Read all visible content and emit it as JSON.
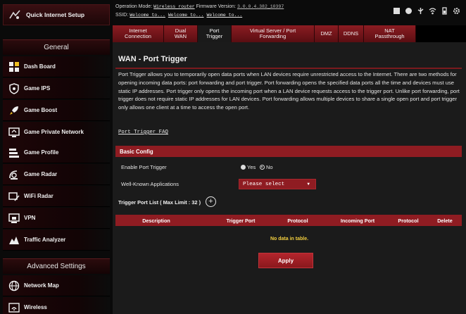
{
  "colors": {
    "accent": "#8f1c22",
    "background": "#1b1b1b",
    "nodata": "#f3cf3f"
  },
  "sidebar": {
    "quick_setup": {
      "label": "Quick Internet Setup",
      "icon": "quick-setup-icon"
    },
    "general_label": "General",
    "items": [
      {
        "label": "Dash Board",
        "icon": "dashboard-icon"
      },
      {
        "label": "Game IPS",
        "icon": "shield-icon"
      },
      {
        "label": "Game Boost",
        "icon": "rocket-icon"
      },
      {
        "label": "Game Private Network",
        "icon": "monitor-icon"
      },
      {
        "label": "Game Profile",
        "icon": "profile-icon"
      },
      {
        "label": "Game Radar",
        "icon": "radar-icon"
      },
      {
        "label": "WiFi Radar",
        "icon": "wifi-radar-icon"
      },
      {
        "label": "VPN",
        "icon": "vpn-icon"
      },
      {
        "label": "Traffic Analyzer",
        "icon": "traffic-icon"
      }
    ],
    "advanced_label": "Advanced Settings",
    "advanced_items": [
      {
        "label": "Network Map",
        "icon": "globe-icon"
      },
      {
        "label": "Wireless",
        "icon": "wireless-icon"
      }
    ]
  },
  "topbar": {
    "mode_label": "Operation Mode:",
    "mode_value": "Wireless router",
    "firmware_label": "Firmware Version:",
    "firmware_value": "3.0.0.4.382_10397",
    "ssid_label": "SSID:",
    "ssids": [
      "Welcome to...",
      "Welcome to...",
      "Welcome to..."
    ],
    "icons": [
      "status-icon",
      "network-icon",
      "usb-icon",
      "wifi-icon",
      "battery-icon",
      "settings-icon"
    ]
  },
  "tabs": [
    {
      "label": "Internet Connection"
    },
    {
      "label": "Dual WAN"
    },
    {
      "label": "Port Trigger",
      "active": true
    },
    {
      "label": "Virtual Server / Port Forwarding"
    },
    {
      "label": "DMZ"
    },
    {
      "label": "DDNS"
    },
    {
      "label": "NAT Passthrough"
    }
  ],
  "main": {
    "title": "WAN - Port Trigger",
    "description": "Port Trigger allows you to temporarily open data ports when LAN devices require unrestricted access to the Internet. There are two methods for opening incoming data ports: port forwarding and port trigger. Port forwarding opens the specified data ports all the time and devices must use static IP addresses. Port trigger only opens the incoming port when a LAN device requests access to the trigger port. Unlike port forwarding, port trigger does not require static IP addresses for LAN devices. Port forwarding allows multiple devices to share a single open port and port trigger only allows one client at a time to access the open port.",
    "faq_link": "Port Trigger FAQ",
    "basic_config": "Basic Config",
    "enable_label": "Enable Port Trigger",
    "yes": "Yes",
    "no": "No",
    "selected": "No",
    "wellknown_label": "Well-Known Applications",
    "select_value": "Please select",
    "list_title": "Trigger Port List ( Max Limit : 32 )",
    "columns": [
      "Description",
      "Trigger Port",
      "Protocol",
      "Incoming Port",
      "Protocol",
      "Delete"
    ],
    "nodata": "No data in table.",
    "apply": "Apply"
  }
}
